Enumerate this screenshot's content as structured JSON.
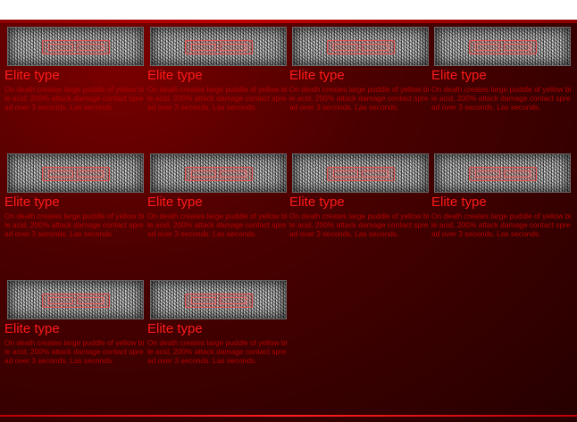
{
  "cards": [
    {
      "title": "Elite type",
      "description": "On death creates large puddle of yellow bile acid, 200% attack damage contact spread over 3 seconds. Las seconds."
    },
    {
      "title": "Elite type",
      "description": "On death creates large puddle of yellow bile acid, 200% attack damage contact spread over 3 seconds. Las seconds."
    },
    {
      "title": "Elite type",
      "description": "On death creates large puddle of yellow bile acid, 200% attack damage contact spread over 3 seconds. Las seconds."
    },
    {
      "title": "Elite type",
      "description": "On death creates large puddle of yellow bile acid, 200% attack damage contact spread over 3 seconds. Las seconds."
    },
    {
      "title": "Elite type",
      "description": "On death creates large puddle of yellow bile acid, 200% attack damage contact spread over 3 seconds. Las seconds."
    },
    {
      "title": "Elite type",
      "description": "On death creates large puddle of yellow bile acid, 200% attack damage contact spread over 3 seconds. Las seconds."
    },
    {
      "title": "Elite type",
      "description": "On death creates large puddle of yellow bile acid, 200% attack damage contact spread over 3 seconds. Las seconds."
    },
    {
      "title": "Elite type",
      "description": "On death creates large puddle of yellow bile acid, 200% attack damage contact spread over 3 seconds. Las seconds."
    },
    {
      "title": "Elite type",
      "description": "On death creates large puddle of yellow bile acid, 200% attack damage contact spread over 3 seconds. Las seconds."
    },
    {
      "title": "Elite type",
      "description": "On death creates large puddle of yellow bile acid, 200% attack damage contact spread over 3 seconds. Las seconds."
    }
  ],
  "colors": {
    "title": "#ff1a1a",
    "description": "#b30000",
    "panel": "#4a0000"
  },
  "icons": {
    "thumbnail": "static-noise-image-icon"
  }
}
